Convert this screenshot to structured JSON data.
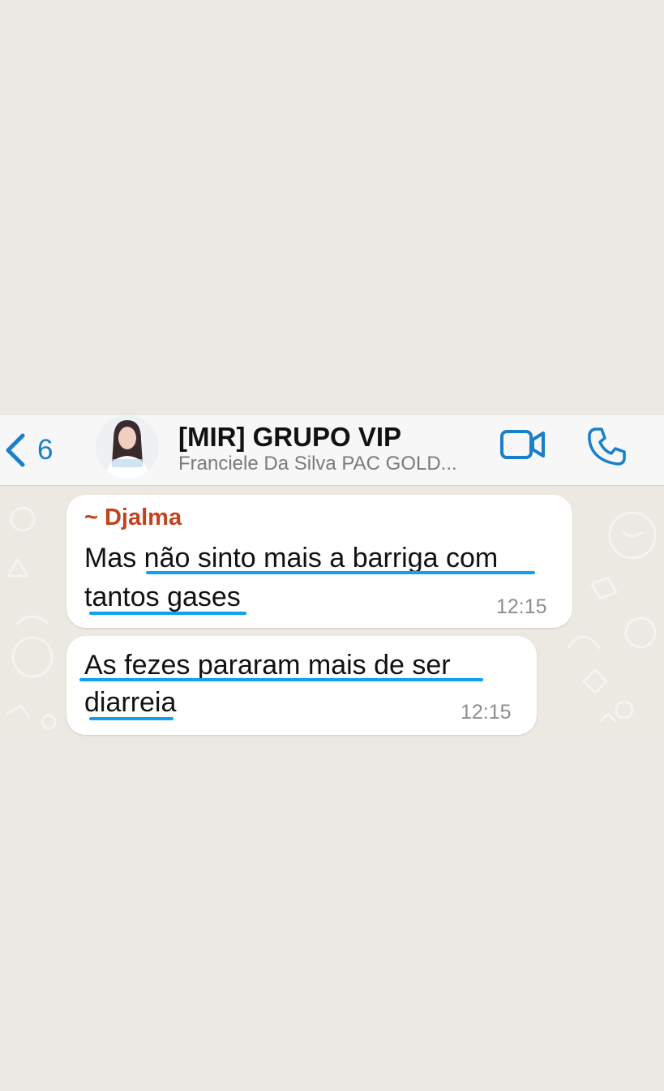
{
  "header": {
    "back_count": "6",
    "title": "[MIR] GRUPO VIP",
    "subtitle": "Franciele Da Silva PAC GOLD..."
  },
  "messages": [
    {
      "sender": "~ Djalma",
      "line1": "Mas não sinto mais a barriga com",
      "line2": "tantos gases",
      "time": "12:15"
    },
    {
      "line1": "As fezes pararam mais de ser",
      "line2": "diarreia",
      "time": "12:15"
    }
  ],
  "colors": {
    "accent": "#1a7fc9",
    "sender_name": "#c4421d",
    "underline": "#0fa0f0",
    "background": "#ebe7e2"
  },
  "icons": [
    "chevron-left-icon",
    "video-camera-icon",
    "phone-icon"
  ]
}
